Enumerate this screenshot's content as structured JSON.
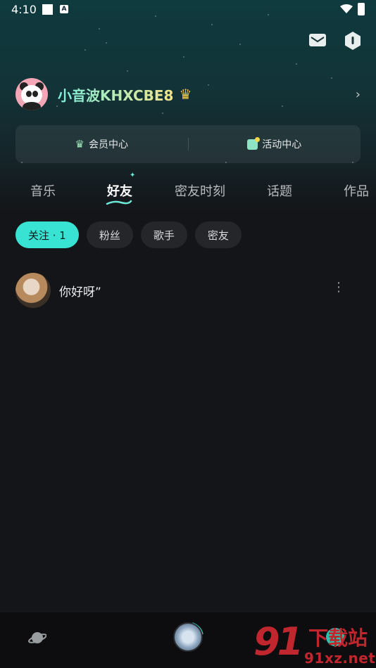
{
  "statusbar": {
    "time": "4:10",
    "a_icon_label": "A"
  },
  "header": {
    "mail_icon": "mail-icon",
    "settings_icon": "hexagon-settings-icon"
  },
  "profile": {
    "username": "小音波KHXCBE8",
    "crown_icon": "crown-icon",
    "chevron": "›"
  },
  "center_card": {
    "vip_label": "会员中心",
    "activity_label": "活动中心"
  },
  "tabs": [
    {
      "label": "音乐",
      "active": false
    },
    {
      "label": "好友",
      "active": true
    },
    {
      "label": "密友时刻",
      "active": false
    },
    {
      "label": "话题",
      "active": false
    },
    {
      "label": "作品",
      "active": false
    }
  ],
  "chips": [
    {
      "label": "关注 · 1",
      "active": true
    },
    {
      "label": "粉丝",
      "active": false
    },
    {
      "label": "歌手",
      "active": false
    },
    {
      "label": "密友",
      "active": false
    }
  ],
  "friends": [
    {
      "name": "你好呀”",
      "more": "⋮"
    }
  ],
  "bottom_nav": {
    "items": [
      "planet-icon",
      "music-disc-icon",
      "profile-icon"
    ]
  },
  "watermark": {
    "logo": "91",
    "title": "下载站",
    "url": "91xz.net"
  },
  "colors": {
    "accent": "#38e3d3",
    "background": "#141518"
  }
}
